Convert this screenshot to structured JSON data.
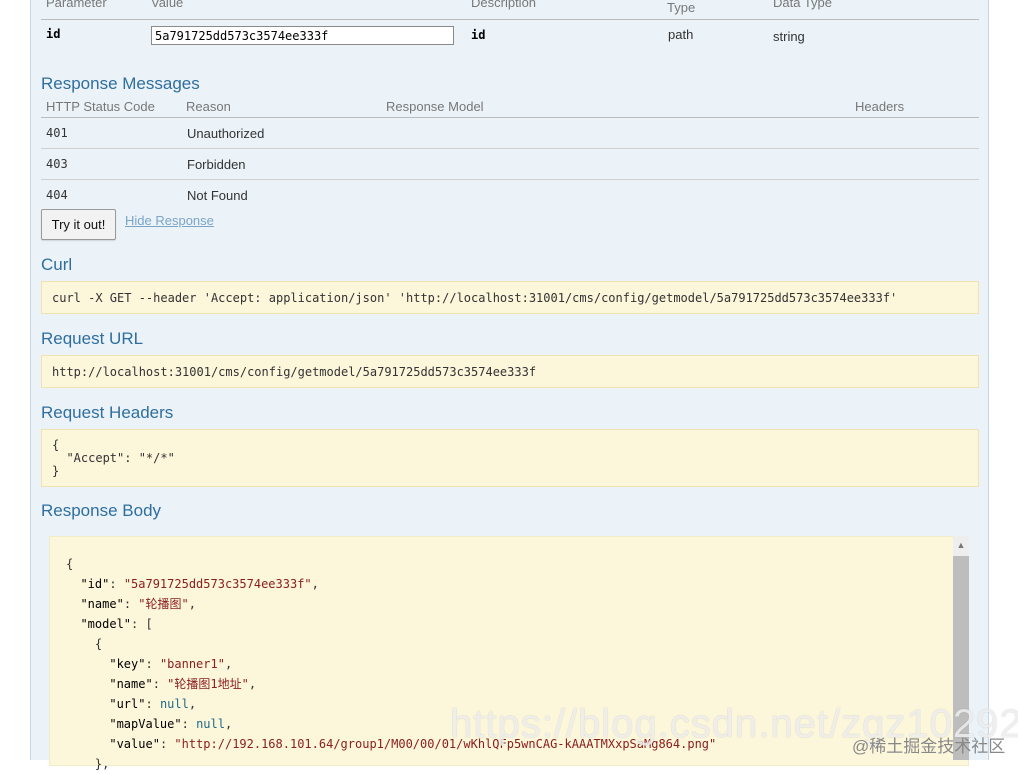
{
  "params_table": {
    "headers": [
      "Parameter",
      "Value",
      "Description",
      "Parameter Type",
      "Data Type"
    ],
    "row": {
      "parameter": "id",
      "value": "5a791725dd573c3574ee333f",
      "description": "id",
      "param_type": "path",
      "data_type": "string"
    }
  },
  "response_messages": {
    "title": "Response Messages",
    "headers": [
      "HTTP Status Code",
      "Reason",
      "Response Model",
      "Headers"
    ],
    "rows": [
      {
        "code": "401",
        "reason": "Unauthorized"
      },
      {
        "code": "403",
        "reason": "Forbidden"
      },
      {
        "code": "404",
        "reason": "Not Found"
      }
    ]
  },
  "actions": {
    "try_label": "Try it out!",
    "hide_label": "Hide Response"
  },
  "curl": {
    "title": "Curl",
    "command": "curl -X GET --header 'Accept: application/json' 'http://localhost:31001/cms/config/getmodel/5a791725dd573c3574ee333f'"
  },
  "request_url": {
    "title": "Request URL",
    "url": "http://localhost:31001/cms/config/getmodel/5a791725dd573c3574ee333f"
  },
  "request_headers": {
    "title": "Request Headers",
    "open": "{",
    "line": "\"Accept\": \"*/*\"",
    "close": "}"
  },
  "response_body": {
    "title": "Response Body",
    "id_value": "\"5a791725dd573c3574ee333f\"",
    "name_value": "\"轮播图\"",
    "key_value": "\"banner1\"",
    "item_name_value": "\"轮播图1地址\"",
    "url_value": "null",
    "mapvalue_value": "null",
    "value_value": "\"http://192.168.101.64/group1/M00/00/01/wKhlQFp5wnCAG-kAAATMXxpSaMg864.png\""
  },
  "watermarks": {
    "main": "https://blog.csdn.net/zgz10292",
    "corner": "@稀土掘金技术社区"
  },
  "colors": {
    "panel_bg": "#ebf3f9",
    "title_blue": "#2f6e9e",
    "code_bg": "#fcf6db",
    "link": "#7aa4c8"
  }
}
